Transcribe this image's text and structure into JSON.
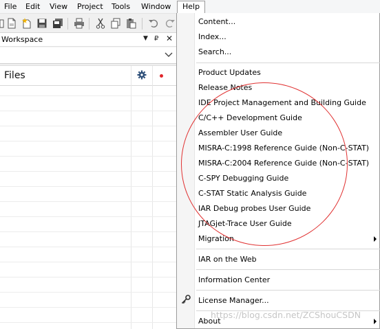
{
  "menubar": {
    "items": [
      "File",
      "Edit",
      "View",
      "Project",
      "Tools",
      "Window",
      "Help"
    ],
    "active": "Help"
  },
  "workspace": {
    "title": "Workspace",
    "files_label": "Files"
  },
  "help_menu": {
    "group1": [
      "Content...",
      "Index...",
      "Search..."
    ],
    "group2": [
      "Product Updates",
      "Release Notes",
      "IDE Project Management and Building Guide",
      "C/C++ Development Guide",
      "Assembler User Guide",
      "MISRA-C:1998 Reference Guide (Non-C-STAT)",
      "MISRA-C:2004 Reference Guide (Non-C-STAT)",
      "C-SPY Debugging Guide",
      "C-STAT Static Analysis Guide",
      "IAR Debug probes User Guide",
      "JTAGjet-Trace User Guide",
      "Migration"
    ],
    "web": "IAR on the Web",
    "info_center": "Information Center",
    "license": "License Manager...",
    "about": "About"
  },
  "colors": {
    "annotation_circle": "#e03030",
    "status_dot": "#e0262b"
  },
  "watermark": "https://blog.csdn.net/ZCShouCSDN"
}
